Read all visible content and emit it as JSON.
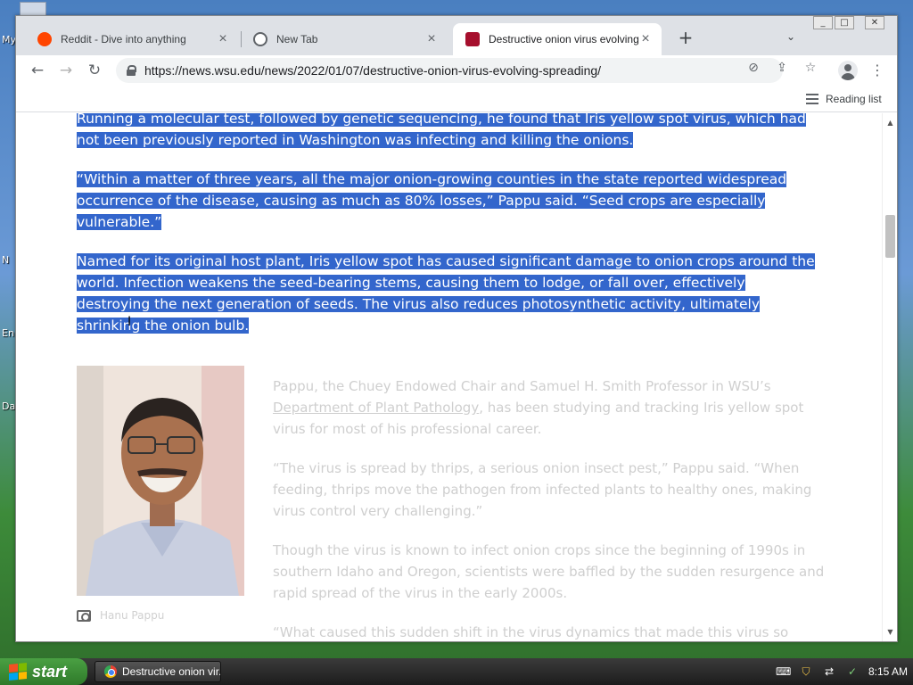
{
  "desktop": {
    "labels": [
      "My",
      "N",
      "En",
      "Da"
    ]
  },
  "browser": {
    "tabs": [
      {
        "title": "Reddit - Dive into anything",
        "favicon": "reddit-icon",
        "color": "#ff4500"
      },
      {
        "title": "New Tab",
        "favicon": "globe-icon",
        "color": "#5f6368"
      },
      {
        "title": "Destructive onion virus evolving, spreading",
        "favicon": "wsu-icon",
        "color": "#a60f2d"
      }
    ],
    "active_tab_index": 2,
    "url": "https://news.wsu.edu/news/2022/01/07/destructive-onion-virus-evolving-spreading/",
    "reading_list_label": "Reading list"
  },
  "article": {
    "selected_paragraphs": [
      "Running a molecular test, followed by genetic sequencing, he found that Iris yellow spot virus, which had not been previously reported in Washington was infecting and killing the onions.",
      "“Within a matter of three years, all the major onion-growing counties in the state reported widespread occurrence of the disease, causing as much as 80% losses,” Pappu said. “Seed crops are especially vulnerable.”",
      "Named for its original host plant, Iris yellow spot has caused significant damage to onion crops around the world. Infection weakens the seed-bearing stems, causing them to lodge, or fall over, effectively destroying the next generation of seeds. The virus also reduces photosynthetic activity, ultimately shrinking the onion bulb."
    ],
    "bio_before_link": "Pappu, the Chuey Endowed Chair and Samuel H. Smith Professor in WSU’s ",
    "bio_link": "Department of Plant Pathology",
    "bio_after_link": ", has been studying and tracking Iris yellow spot virus for most of his professional career.",
    "paragraphs": [
      "“The virus is spread by thrips, a serious onion insect pest,” Pappu said. “When feeding, thrips move the pathogen from infected plants to healthy ones, making virus control very challenging.”",
      "Though the virus is known to infect onion crops since the beginning of 1990s in southern Idaho and Oregon, scientists were baffled by the sudden resurgence and rapid spread of the virus in the early 2000s.",
      "“What caused this sudden shift in the virus dynamics that made this virus so destructive, so suddenly?” Pappu said. “It’s still an unsolved puzzle.”"
    ],
    "photo_caption": "Hanu Pappu"
  },
  "taskbar": {
    "start_label": "start",
    "items": [
      {
        "title": "Destructive onion vir..."
      }
    ],
    "clock": "8:15 AM"
  },
  "colors": {
    "selection": "#3366cc",
    "start_green": "#3c9a3a"
  }
}
